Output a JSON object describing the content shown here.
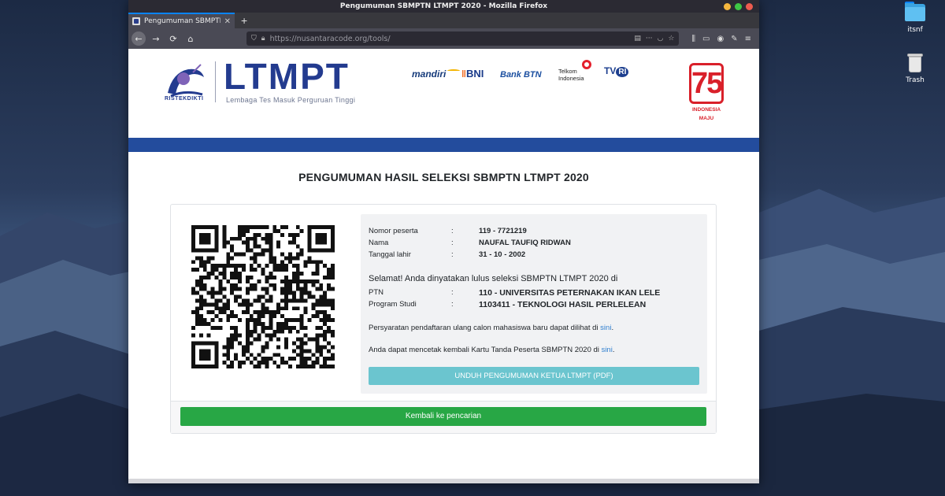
{
  "desktop": {
    "icons": [
      {
        "label": "itsnf"
      },
      {
        "label": "Trash"
      }
    ]
  },
  "window": {
    "title": "Pengumuman SBMPTN LTMPT 2020 - Mozilla Firefox",
    "tab_title": "Pengumuman SBMPTN LTMPT 2020",
    "new_tab_symbol": "+",
    "url": "https://nusantaracode.org/tools/"
  },
  "header": {
    "logo_word": "LTMPT",
    "logo_subtitle": "Lembaga Tes Masuk Perguruan Tinggi",
    "emblem_caption": "RISTEKDIKTI",
    "sponsors": {
      "mandiri": "mandiri",
      "bni": "BNI",
      "btn_prefix": "Bank",
      "btn": "BTN",
      "telkom_line1": "Telkom",
      "telkom_line2": "Indonesia",
      "tvri_tv": "TV",
      "tvri_ri": "RI"
    },
    "badge_number": "75",
    "badge_caption_1": "INDONESIA",
    "badge_caption_2": "MAJU"
  },
  "main": {
    "title": "PENGUMUMAN HASIL SELEKSI SBMPTN LTMPT 2020",
    "fields": [
      {
        "label": "Nomor peserta",
        "sep": ":",
        "value": "119 - 7721219"
      },
      {
        "label": "Nama",
        "sep": ":",
        "value": "NAUFAL TAUFIQ RIDWAN"
      },
      {
        "label": "Tanggal lahir",
        "sep": ":",
        "value": "31 - 10 - 2002"
      }
    ],
    "lulus_text": "Selamat! Anda dinyatakan lulus seleksi SBMPTN LTMPT 2020 di",
    "result": [
      {
        "label": "PTN",
        "sep": ":",
        "value": "110 - UNIVERSITAS PETERNAKAN IKAN LELE"
      },
      {
        "label": "Program Studi",
        "sep": ":",
        "value": "1103411 - TEKNOLOGI HASIL PERLELEAN"
      }
    ],
    "para1_text": "Persyaratan pendaftaran ulang calon mahasiswa baru dapat dilihat di",
    "para1_link": "sini",
    "para2_text": "Anda dapat mencetak kembali Kartu Tanda Peserta SBMPTN 2020 di",
    "para2_link": "sini",
    "download_button": "UNDUH PENGUMUMAN KETUA LTMPT (PDF)",
    "back_button": "Kembali ke pencarian"
  },
  "colors": {
    "brand_blue": "#234c9d",
    "download_button": "#6bc5cf",
    "back_button": "#28a745",
    "badge_red": "#d9202a"
  }
}
